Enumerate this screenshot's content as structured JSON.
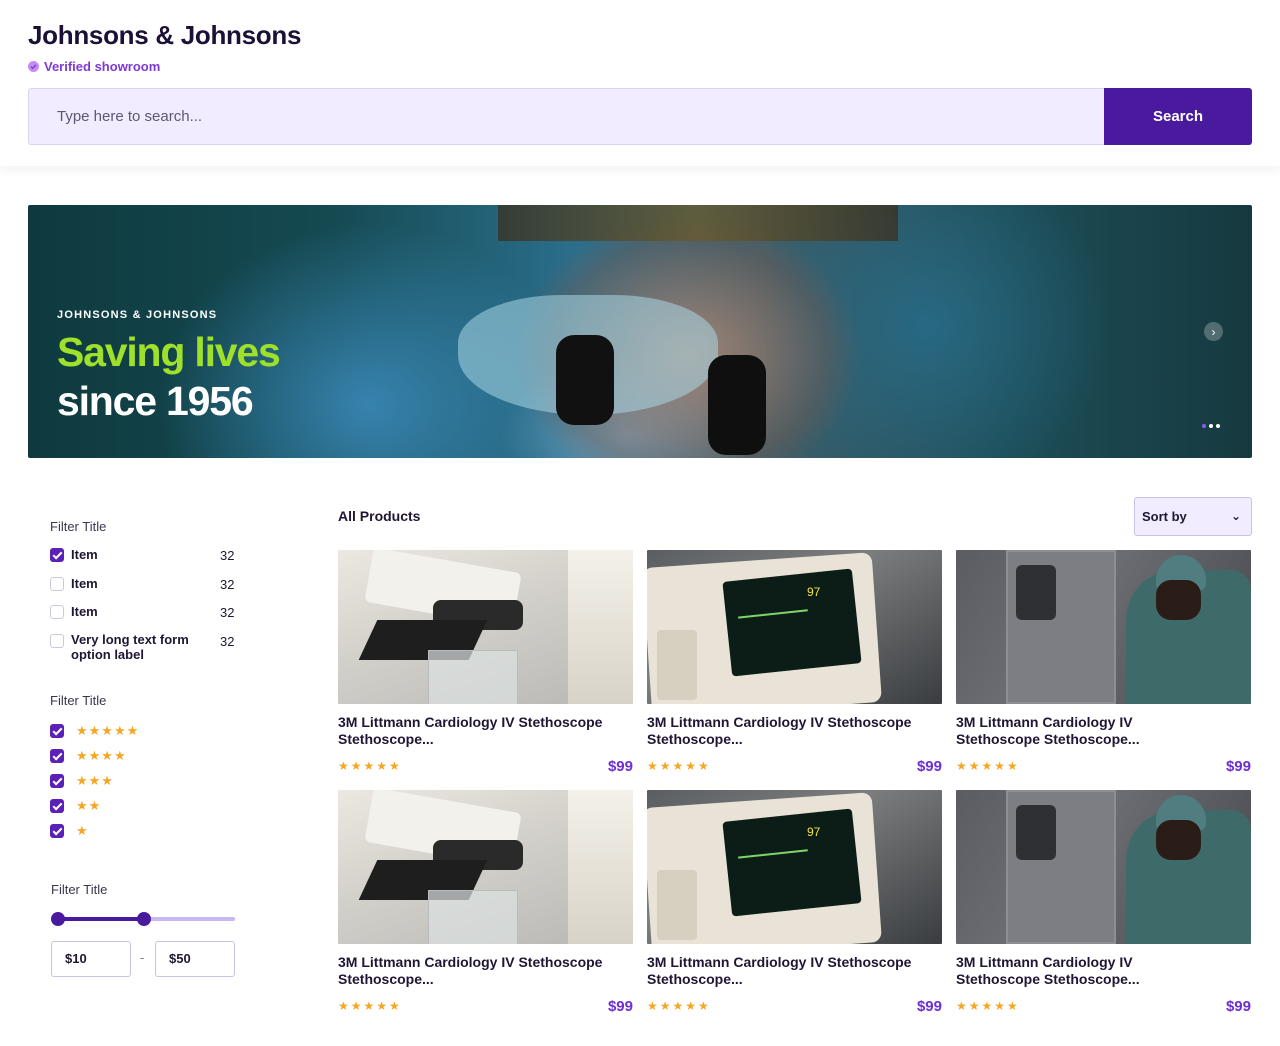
{
  "header": {
    "shop_name": "Johnsons & Johnsons",
    "verified_label": "Verified showroom",
    "search_placeholder": "Type here to search...",
    "search_button": "Search"
  },
  "hero": {
    "brand": "JOHNSONS & JOHNSONS",
    "headline_1": "Saving lives",
    "headline_2": "since 1956",
    "next_icon": "chevron-right-icon",
    "slide_count": 3,
    "active_slide": 1
  },
  "filters": {
    "group1": {
      "title": "Filter Title",
      "options": [
        {
          "label": "Item",
          "count": "32",
          "checked": true
        },
        {
          "label": "Item",
          "count": "32",
          "checked": false
        },
        {
          "label": "Item",
          "count": "32",
          "checked": false
        },
        {
          "label": "Very long text form option label",
          "count": "32",
          "checked": false
        }
      ]
    },
    "group2": {
      "title": "Filter Title",
      "ratings": [
        {
          "stars": 5,
          "checked": true
        },
        {
          "stars": 4,
          "checked": true
        },
        {
          "stars": 3,
          "checked": true
        },
        {
          "stars": 2,
          "checked": true
        },
        {
          "stars": 1,
          "checked": true
        }
      ]
    },
    "group3": {
      "title": "Filter Title",
      "min": "$10",
      "max": "$50",
      "range_fraction": [
        0.0,
        0.49
      ]
    }
  },
  "products": {
    "heading": "All Products",
    "sort_label": "Sort by",
    "items": [
      {
        "title": "3M Littmann Cardiology IV Stethoscope Stethoscope...",
        "price": "$99",
        "rating": 5,
        "image": "microscope"
      },
      {
        "title": "3M Littmann Cardiology IV Stethoscope Stethoscope...",
        "price": "$99",
        "rating": 5,
        "image": "patient-monitor"
      },
      {
        "title": "3M Littmann Cardiology IV Stethoscope Stethoscope...",
        "price": "$99",
        "rating": 5,
        "image": "surgeon-washing"
      },
      {
        "title": "3M Littmann Cardiology IV Stethoscope Stethoscope...",
        "price": "$99",
        "rating": 5,
        "image": "microscope"
      },
      {
        "title": "3M Littmann Cardiology IV Stethoscope Stethoscope...",
        "price": "$99",
        "rating": 5,
        "image": "patient-monitor"
      },
      {
        "title": "3M Littmann Cardiology IV Stethoscope Stethoscope...",
        "price": "$99",
        "rating": 5,
        "image": "surgeon-washing"
      }
    ]
  },
  "colors": {
    "primary": "#4a1a9e",
    "accent_green": "#9fe02a",
    "price": "#6d2fd1",
    "star": "#f6a623",
    "search_bg": "#f1ecff"
  }
}
